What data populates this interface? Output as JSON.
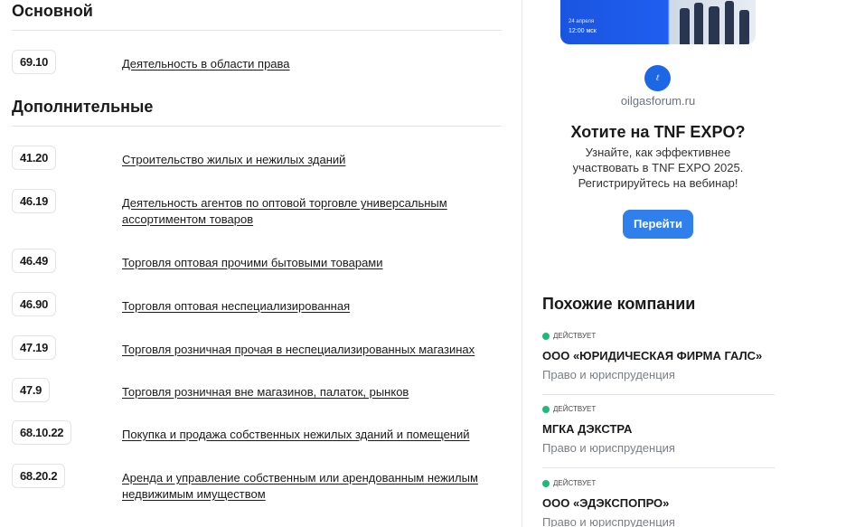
{
  "main_section": {
    "title": "Основной",
    "codes": [
      {
        "code": "69.10",
        "name": "Деятельность в области права"
      }
    ]
  },
  "extra_section": {
    "title": "Дополнительные",
    "codes": [
      {
        "code": "41.20",
        "name": "Строительство жилых и нежилых зданий"
      },
      {
        "code": "46.19",
        "name": "Деятельность агентов по оптовой торговле универсальным ассортиментом товаров"
      },
      {
        "code": "46.49",
        "name": "Торговля оптовая прочими бытовыми товарами"
      },
      {
        "code": "46.90",
        "name": "Торговля оптовая неспециализированная"
      },
      {
        "code": "47.19",
        "name": "Торговля розничная прочая в неспециализированных магазинах"
      },
      {
        "code": "47.9",
        "name": "Торговля розничная вне магазинов, палаток, рынков"
      },
      {
        "code": "68.10.22",
        "name": "Покупка и продажа собственных нежилых зданий и помещений"
      },
      {
        "code": "68.20.2",
        "name": "Аренда и управление собственным или арендованным нежилым недвижимым имуществом"
      }
    ]
  },
  "ad": {
    "banner_date": "24 апреля",
    "banner_time": "12:00 мск",
    "domain": "oilgasforum.ru",
    "title": "Хотите на TNF EXPO?",
    "text": "Узнайте, как эффективнее участвовать в TNF EXPO 2025. Регистрируйтесь на вебинар!",
    "button": "Перейти",
    "accent": "#2f80ed",
    "logo_icon": "tnf-logo-icon"
  },
  "similar": {
    "title": "Похожие компании",
    "status_color": "#1fb978",
    "items": [
      {
        "status": "действует",
        "name": "ООО «ЮРИДИЧЕСКАЯ ФИРМА ГАЛС»",
        "category": "Право и юриспруденция"
      },
      {
        "status": "действует",
        "name": "МГКА ДЭКСТРА",
        "category": "Право и юриспруденция"
      },
      {
        "status": "действует",
        "name": "ООО «ЭДЭКСПОПРО»",
        "category": "Право и юриспруденция"
      }
    ]
  }
}
